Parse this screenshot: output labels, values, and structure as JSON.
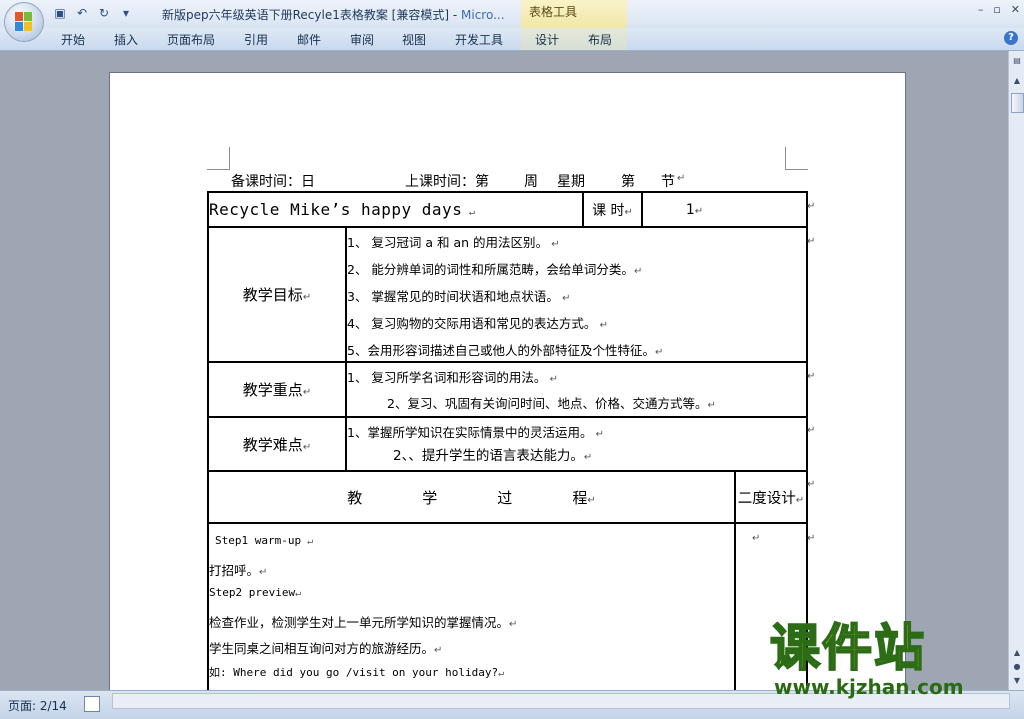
{
  "window": {
    "title": "新版pep六年级英语下册Recyle1表格教案 [兼容模式]",
    "title_app": "Micro...",
    "context_tab_group": "表格工具",
    "controls": [
      "–",
      "▫",
      "✕"
    ]
  },
  "ribbon": {
    "tabs": [
      "开始",
      "插入",
      "页面布局",
      "引用",
      "邮件",
      "审阅",
      "视图",
      "开发工具",
      "设计",
      "布局"
    ]
  },
  "document": {
    "header_line": {
      "prep_time": "备课时间：日",
      "class_time": "上课时间：第",
      "week": "周",
      "weekday": "星期",
      "order": "第",
      "section": "节"
    },
    "topic": "Recycle  Mike’s happy days",
    "period_label": "课 时",
    "period_value": "1",
    "objectives_label": "教学目标",
    "objectives": [
      "1、   复习冠词 a 和 an 的用法区别。",
      "2、   能分辨单词的词性和所属范畴，会给单词分类。",
      "3、   掌握常见的时间状语和地点状语。",
      "4、   复习购物的交际用语和常见的表达方式。",
      "5、会用形容词描述自己或他人的外部特征及个性特征。"
    ],
    "keypoints_label": "教学重点",
    "keypoints": [
      "1、   复习所学名词和形容词的用法。",
      "2、复习、巩固有关询问时间、地点、价格、交通方式等。"
    ],
    "difficulties_label": "教学难点",
    "difficulties": [
      "1、掌握所学知识在实际情景中的灵活运用。",
      "2、、提升学生的语言表达能力。"
    ],
    "process_label": [
      "教",
      "学",
      "过",
      "程"
    ],
    "second_design_label": "二度设计",
    "process_lines": [
      "Step1 warm-up",
      "打招呼。",
      "Step2 preview",
      "检查作业，检测学生对上一单元所学知识的掌握情况。",
      "学生同桌之间相互询问对方的旅游经历。",
      "如: Where did you go /visit on your holiday?"
    ]
  },
  "status": {
    "page_info": "页面: 2/14"
  },
  "watermark": {
    "cn": "课件站",
    "url": "www.kjzhan.com"
  }
}
